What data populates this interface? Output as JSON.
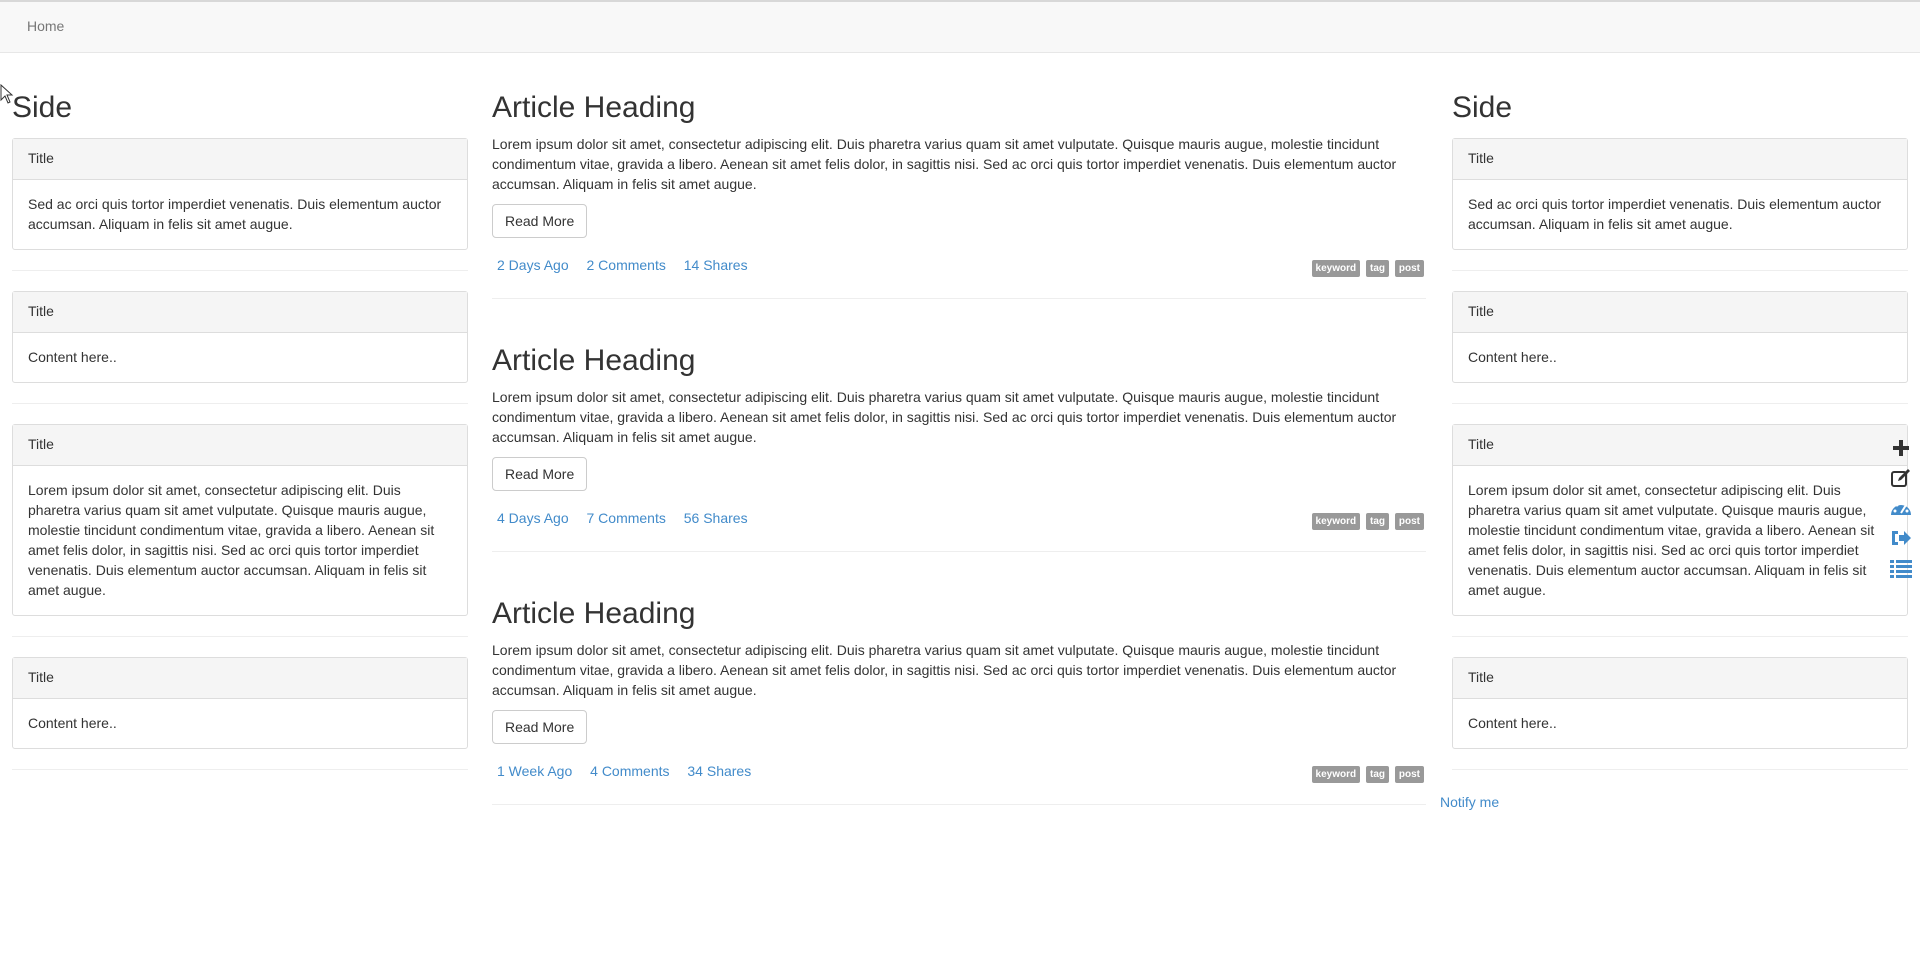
{
  "navbar": {
    "brand": "Home"
  },
  "left_sidebar": {
    "heading": "Side",
    "panels": [
      {
        "title": "Title",
        "body": "Sed ac orci quis tortor imperdiet venenatis. Duis elementum auctor accumsan. Aliquam in felis sit amet augue."
      },
      {
        "title": "Title",
        "body": "Content here.."
      },
      {
        "title": "Title",
        "body": "Lorem ipsum dolor sit amet, consectetur adipiscing elit. Duis pharetra varius quam sit amet vulputate. Quisque mauris augue, molestie tincidunt condimentum vitae, gravida a libero. Aenean sit amet felis dolor, in sagittis nisi. Sed ac orci quis tortor imperdiet venenatis. Duis elementum auctor accumsan. Aliquam in felis sit amet augue."
      },
      {
        "title": "Title",
        "body": "Content here.."
      }
    ]
  },
  "articles": [
    {
      "heading": "Article Heading",
      "body": "Lorem ipsum dolor sit amet, consectetur adipiscing elit. Duis pharetra varius quam sit amet vulputate. Quisque mauris augue, molestie tincidunt condimentum vitae, gravida a libero. Aenean sit amet felis dolor, in sagittis nisi. Sed ac orci quis tortor imperdiet venenatis. Duis elementum auctor accumsan. Aliquam in felis sit amet augue.",
      "button": "Read More",
      "date": "2 Days Ago",
      "comments": "2 Comments",
      "shares": "14 Shares",
      "tags": [
        "keyword",
        "tag",
        "post"
      ]
    },
    {
      "heading": "Article Heading",
      "body": "Lorem ipsum dolor sit amet, consectetur adipiscing elit. Duis pharetra varius quam sit amet vulputate. Quisque mauris augue, molestie tincidunt condimentum vitae, gravida a libero. Aenean sit amet felis dolor, in sagittis nisi. Sed ac orci quis tortor imperdiet venenatis. Duis elementum auctor accumsan. Aliquam in felis sit amet augue.",
      "button": "Read More",
      "date": "4 Days Ago",
      "comments": "7 Comments",
      "shares": "56 Shares",
      "tags": [
        "keyword",
        "tag",
        "post"
      ]
    },
    {
      "heading": "Article Heading",
      "body": "Lorem ipsum dolor sit amet, consectetur adipiscing elit. Duis pharetra varius quam sit amet vulputate. Quisque mauris augue, molestie tincidunt condimentum vitae, gravida a libero. Aenean sit amet felis dolor, in sagittis nisi. Sed ac orci quis tortor imperdiet venenatis. Duis elementum auctor accumsan. Aliquam in felis sit amet augue.",
      "button": "Read More",
      "date": "1 Week Ago",
      "comments": "4 Comments",
      "shares": "34 Shares",
      "tags": [
        "keyword",
        "tag",
        "post"
      ]
    }
  ],
  "right_sidebar": {
    "heading": "Side",
    "panels": [
      {
        "title": "Title",
        "body": "Sed ac orci quis tortor imperdiet venenatis. Duis elementum auctor accumsan. Aliquam in felis sit amet augue."
      },
      {
        "title": "Title",
        "body": "Content here.."
      },
      {
        "title": "Title",
        "body": "Lorem ipsum dolor sit amet, consectetur adipiscing elit. Duis pharetra varius quam sit amet vulputate. Quisque mauris augue, molestie tincidunt condimentum vitae, gravida a libero. Aenean sit amet felis dolor, in sagittis nisi. Sed ac orci quis tortor imperdiet venenatis. Duis elementum auctor accumsan. Aliquam in felis sit amet augue."
      },
      {
        "title": "Title",
        "body": "Content here.."
      }
    ],
    "notify_link": "Notify me"
  },
  "toolbar": {
    "icons": [
      "plus-icon",
      "edit-icon",
      "dashboard-icon",
      "logout-icon",
      "list-icon"
    ],
    "color_dark": "#333333",
    "color_accent": "#428bca"
  },
  "colors": {
    "link": "#428bca",
    "label": "#999999",
    "panel_heading": "#f5f5f5",
    "navbar": "#f8f8f8"
  }
}
